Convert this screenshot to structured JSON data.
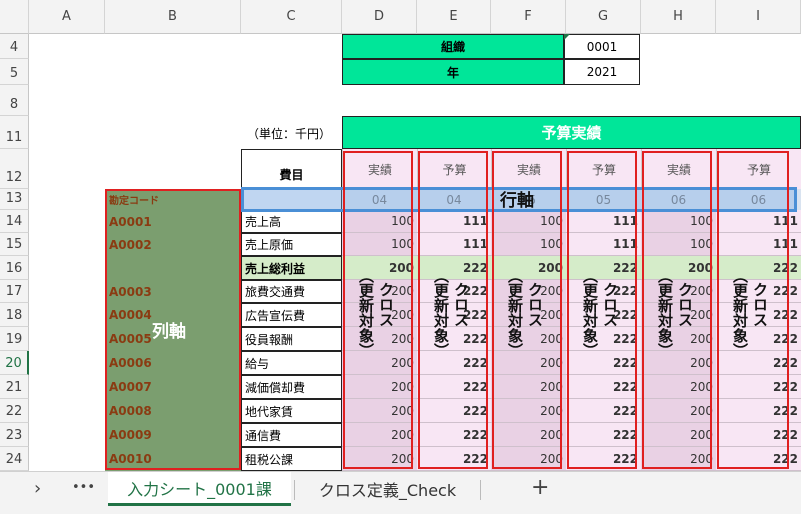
{
  "columns": [
    "A",
    "B",
    "C",
    "D",
    "E",
    "F",
    "G",
    "H",
    "I"
  ],
  "rows": [
    "4",
    "5",
    "8",
    "11",
    "12",
    "13",
    "14",
    "15",
    "16",
    "17",
    "18",
    "19",
    "20",
    "21",
    "22",
    "23",
    "24"
  ],
  "header": {
    "org_label": "組織",
    "org_value": "0001",
    "year_label": "年",
    "year_value": "2021",
    "unit_label": "（単位：千円）",
    "title": "予算実績",
    "item_label": "費目",
    "code_label": "勘定コード"
  },
  "col_headers": [
    "実績",
    "予算",
    "実績",
    "予算",
    "実績",
    "予算"
  ],
  "months": [
    "04",
    "04",
    "05",
    "05",
    "06",
    "06"
  ],
  "row_axis_label": "行軸",
  "col_axis_label": "列軸",
  "cross_label": "クロス",
  "cross_sub": "（更新対象）",
  "data_rows": [
    {
      "code": "A0001",
      "name": "売上高",
      "vals": [
        "100",
        "111",
        "100",
        "111",
        "100",
        "111"
      ]
    },
    {
      "code": "A0002",
      "name": "売上原価",
      "vals": [
        "100",
        "111",
        "100",
        "111",
        "100",
        "111"
      ]
    },
    {
      "code": "",
      "name": "売上総利益",
      "vals": [
        "200",
        "222",
        "200",
        "222",
        "200",
        "222"
      ]
    },
    {
      "code": "A0003",
      "name": "旅費交通費",
      "vals": [
        "200",
        "222",
        "200",
        "222",
        "200",
        "222"
      ]
    },
    {
      "code": "A0004",
      "name": "広告宣伝費",
      "vals": [
        "200",
        "222",
        "200",
        "222",
        "200",
        "222"
      ]
    },
    {
      "code": "A0005",
      "name": "役員報酬",
      "vals": [
        "200",
        "222",
        "200",
        "222",
        "200",
        "222"
      ]
    },
    {
      "code": "A0006",
      "name": "給与",
      "vals": [
        "200",
        "222",
        "200",
        "222",
        "200",
        "222"
      ]
    },
    {
      "code": "A0007",
      "name": "減価償却費",
      "vals": [
        "200",
        "222",
        "200",
        "222",
        "200",
        "222"
      ]
    },
    {
      "code": "A0008",
      "name": "地代家賃",
      "vals": [
        "200",
        "222",
        "200",
        "222",
        "200",
        "222"
      ]
    },
    {
      "code": "A0009",
      "name": "通信費",
      "vals": [
        "200",
        "222",
        "200",
        "222",
        "200",
        "222"
      ]
    },
    {
      "code": "A0010",
      "name": "租税公課",
      "vals": [
        "200",
        "222",
        "200",
        "222",
        "200",
        "222"
      ]
    }
  ],
  "tabs": {
    "nav_prev": "›",
    "more": "•••",
    "sheet1": "入力シート_0001課",
    "sheet2": "クロス定義_Check",
    "add": "+"
  },
  "colors": {
    "accent_green": "#00e699",
    "excel_green": "#217346",
    "highlight_red": "#e02020",
    "highlight_blue": "#4a8fd6"
  }
}
